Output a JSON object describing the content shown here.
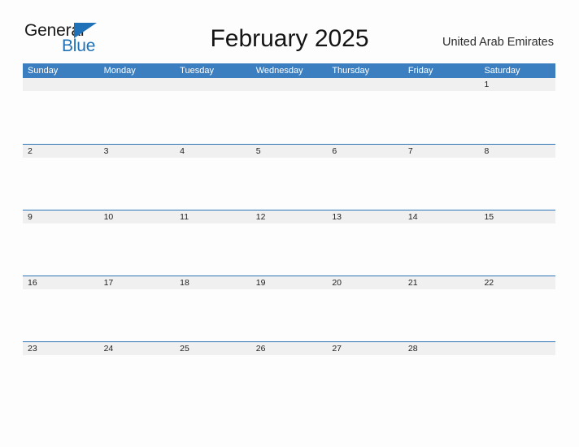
{
  "brand": {
    "name_part1": "General",
    "name_part2": "Blue",
    "accent_color": "#1f72b8",
    "triangle_icon": "triangle-icon"
  },
  "header": {
    "title": "February 2025",
    "locale": "United Arab Emirates"
  },
  "calendar": {
    "month": "February",
    "year": "2025",
    "header_bg": "#3c7fc0",
    "band_bg": "#f0f0f0",
    "rule_color": "#2e75b6",
    "weekdays": [
      "Sunday",
      "Monday",
      "Tuesday",
      "Wednesday",
      "Thursday",
      "Friday",
      "Saturday"
    ],
    "weeks": [
      [
        "",
        "",
        "",
        "",
        "",
        "",
        "1"
      ],
      [
        "2",
        "3",
        "4",
        "5",
        "6",
        "7",
        "8"
      ],
      [
        "9",
        "10",
        "11",
        "12",
        "13",
        "14",
        "15"
      ],
      [
        "16",
        "17",
        "18",
        "19",
        "20",
        "21",
        "22"
      ],
      [
        "23",
        "24",
        "25",
        "26",
        "27",
        "28",
        ""
      ]
    ]
  }
}
